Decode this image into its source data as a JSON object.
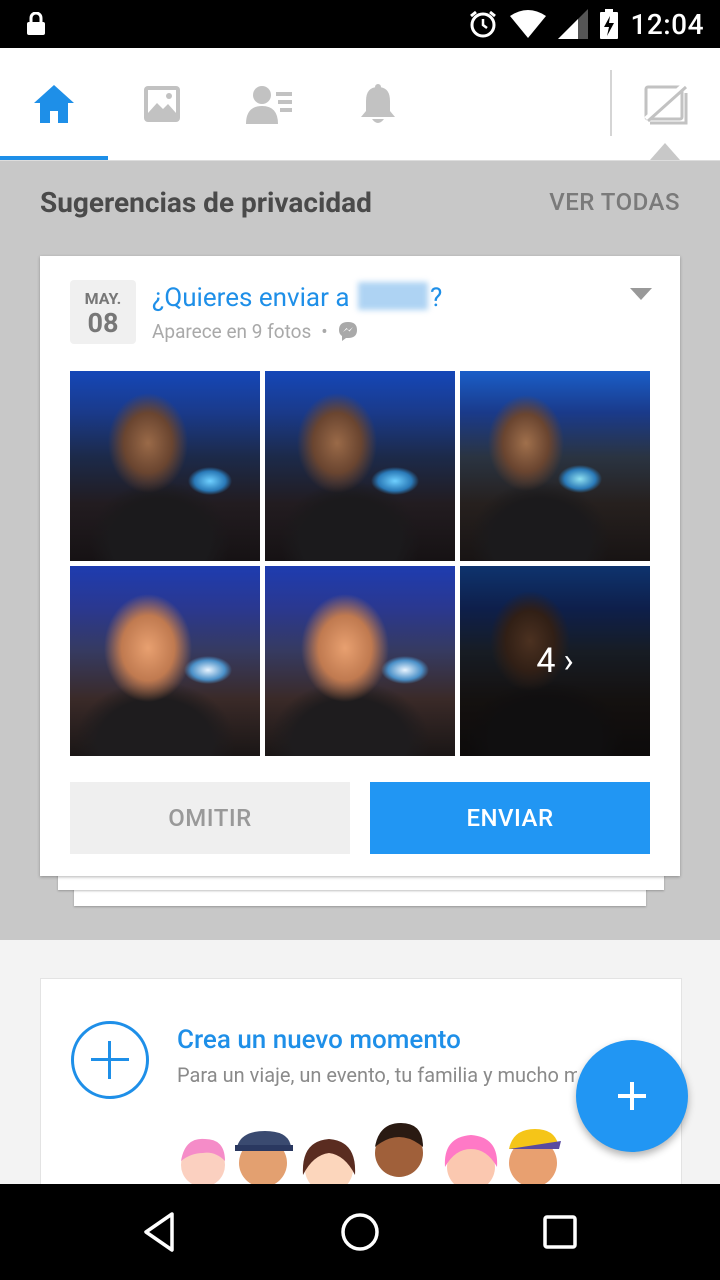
{
  "status_bar": {
    "time": "12:04"
  },
  "tabs": [
    {
      "name": "home",
      "active": true
    },
    {
      "name": "photos",
      "active": false
    },
    {
      "name": "contacts",
      "active": false
    },
    {
      "name": "notifications",
      "active": false
    }
  ],
  "section": {
    "title": "Sugerencias de privacidad",
    "see_all": "VER TODAS"
  },
  "card": {
    "date_month": "MAY.",
    "date_day": "08",
    "title_prefix": "¿Quieres enviar a",
    "title_suffix": "?",
    "subtitle": "Aparece en 9 fotos",
    "subtitle_separator": "•",
    "more_photos_count": "4",
    "more_photos_chevron": "›",
    "skip_label": "OMITIR",
    "send_label": "ENVIAR"
  },
  "moment": {
    "title": "Crea un nuevo momento",
    "subtitle": "Para un viaje, un evento, tu familia y mucho más"
  },
  "colors": {
    "accent": "#2196f3",
    "accent_text": "#1e8fe8"
  }
}
